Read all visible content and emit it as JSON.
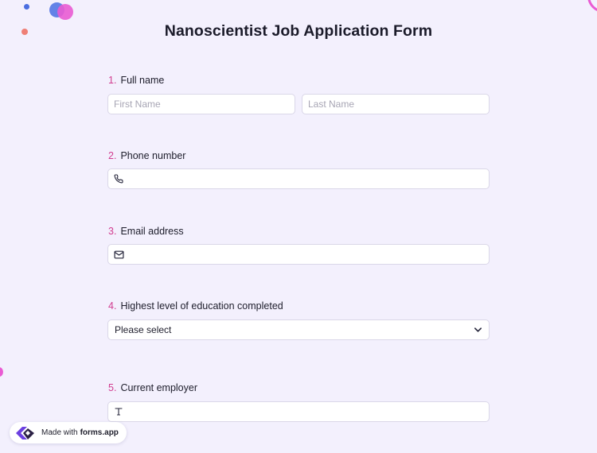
{
  "form": {
    "title": "Nanoscientist Job Application Form",
    "questions": [
      {
        "number": "1.",
        "label": "Full name",
        "fields": [
          {
            "placeholder": "First Name"
          },
          {
            "placeholder": "Last Name"
          }
        ]
      },
      {
        "number": "2.",
        "label": "Phone number",
        "icon": "phone-icon"
      },
      {
        "number": "3.",
        "label": "Email address",
        "icon": "envelope-icon"
      },
      {
        "number": "4.",
        "label": "Highest level of education completed",
        "selected": "Please select",
        "icon": "chevron-down-icon"
      },
      {
        "number": "5.",
        "label": "Current employer",
        "icon": "text-type-icon"
      }
    ]
  },
  "badge": {
    "prefix": "Made with",
    "brand": "forms.app",
    "logo_icon": "forms-app-logo-icon"
  },
  "colors": {
    "background": "#f3f0fd",
    "accent_number": "#d13c8f",
    "brand_purple": "#6b3fe0",
    "decor_pink": "#e95bd3",
    "decor_blue": "#5b7be6",
    "decor_coral": "#ef7f76"
  }
}
